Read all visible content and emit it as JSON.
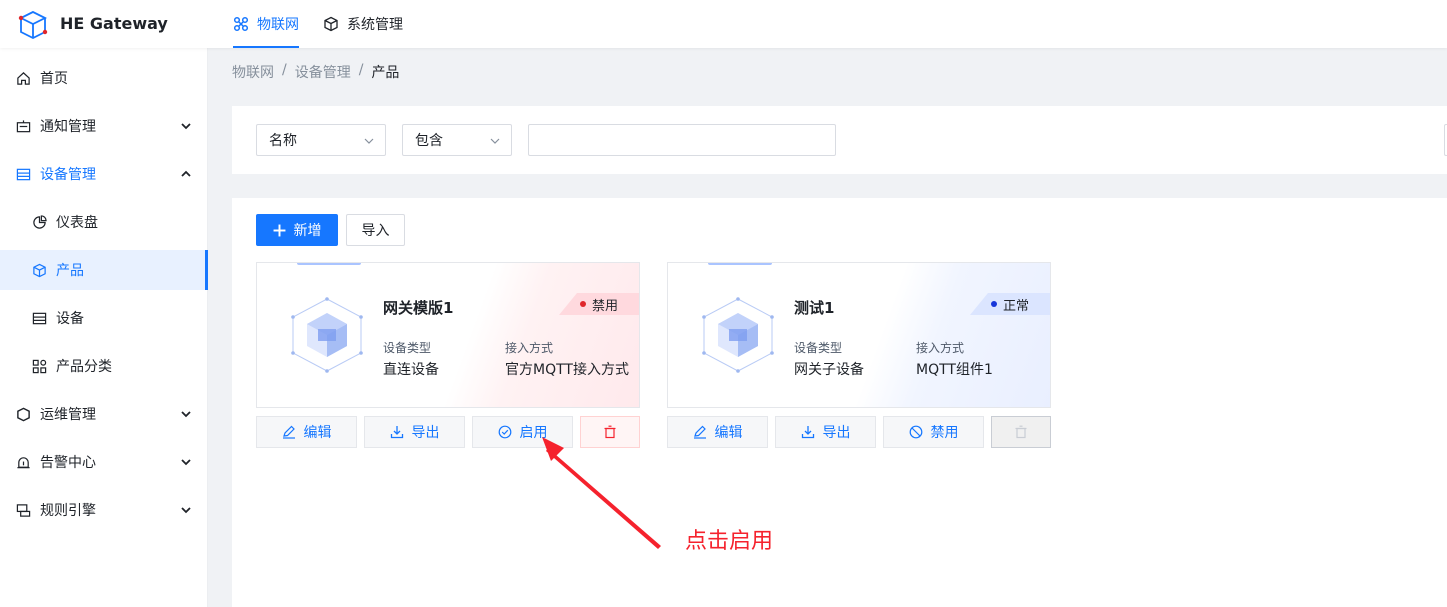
{
  "app": {
    "title": "HE Gateway"
  },
  "nav": {
    "tabs": [
      {
        "label": "物联网",
        "active": true
      },
      {
        "label": "系统管理",
        "active": false
      }
    ]
  },
  "sidebar": {
    "items": [
      {
        "label": "首页",
        "icon": "home-icon"
      },
      {
        "label": "通知管理",
        "icon": "notification-icon"
      },
      {
        "label": "设备管理",
        "icon": "device-list-icon",
        "expanded": true
      },
      {
        "label": "仪表盘",
        "icon": "dashboard-icon",
        "sub": true
      },
      {
        "label": "产品",
        "icon": "cube-icon",
        "sub": true,
        "active": true
      },
      {
        "label": "设备",
        "icon": "device-icon",
        "sub": true
      },
      {
        "label": "产品分类",
        "icon": "category-icon",
        "sub": true
      },
      {
        "label": "运维管理",
        "icon": "ops-icon"
      },
      {
        "label": "告警中心",
        "icon": "alarm-icon"
      },
      {
        "label": "规则引擎",
        "icon": "rule-icon"
      }
    ]
  },
  "breadcrumb": [
    "物联网",
    "/",
    "设备管理",
    "/",
    "产品"
  ],
  "filter": {
    "field_select": "名称",
    "operator_select": "包含",
    "value": ""
  },
  "toolbar": {
    "add_label": "新增",
    "import_label": "导入"
  },
  "cards": [
    {
      "name": "网关模版1",
      "status": "禁用",
      "status_color": "#e0262b",
      "type_label": "设备类型",
      "type_value": "直连设备",
      "access_label": "接入方式",
      "access_value": "官方MQTT接入方式",
      "actions": {
        "edit": "编辑",
        "export": "导出",
        "toggle": "启用"
      }
    },
    {
      "name": "测试1",
      "status": "正常",
      "status_color": "#1636d9",
      "type_label": "设备类型",
      "type_value": "网关子设备",
      "access_label": "接入方式",
      "access_value": "MQTT组件1",
      "actions": {
        "edit": "编辑",
        "export": "导出",
        "toggle": "禁用"
      }
    }
  ],
  "annotation": {
    "text": "点击启用",
    "color": "#f5222d"
  },
  "colors": {
    "primary": "#1677ff",
    "danger": "#f5222d"
  }
}
